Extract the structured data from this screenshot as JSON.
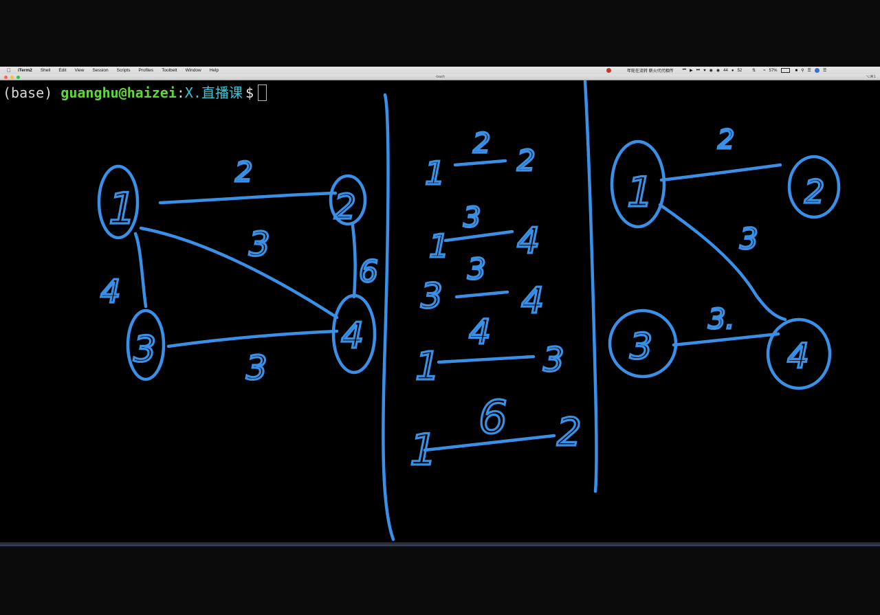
{
  "menubar": {
    "app_name": "iTerm2",
    "items": [
      "Shell",
      "Edit",
      "View",
      "Session",
      "Scripts",
      "Profiles",
      "Toolbelt",
      "Window",
      "Help"
    ],
    "now_playing": "年轮在流转 薪火代代相传",
    "badge_1": "44",
    "badge_2": "52",
    "battery": "57%"
  },
  "window": {
    "title": "-bash",
    "shortcut": "⌥⌘1"
  },
  "terminal": {
    "prompt_env": "(base)",
    "prompt_user": "guanghu@haizei",
    "prompt_sep": ":",
    "prompt_path": "X.直播课",
    "prompt_symbol": "$"
  },
  "annotation": {
    "color": "#3a8fe6",
    "left_graph": {
      "nodes": [
        "1",
        "2",
        "3",
        "4"
      ],
      "edges": [
        {
          "from": "1",
          "to": "2",
          "weight": "2"
        },
        {
          "from": "1",
          "to": "4",
          "weight": "3"
        },
        {
          "from": "1",
          "to": "3",
          "weight": "4"
        },
        {
          "from": "3",
          "to": "4",
          "weight": "3"
        },
        {
          "from": "2",
          "to": "4",
          "weight": "6"
        }
      ]
    },
    "sorted_edges": [
      {
        "u": "1",
        "w": "2",
        "v": "2"
      },
      {
        "u": "1",
        "w": "3",
        "v": "4"
      },
      {
        "u": "3",
        "w": "3",
        "v": "4"
      },
      {
        "u": "1",
        "w": "4",
        "v": "3"
      },
      {
        "u": "1",
        "w": "6",
        "v": "2"
      }
    ],
    "right_graph": {
      "nodes": [
        "1",
        "2",
        "3",
        "4"
      ],
      "edges": [
        {
          "from": "1",
          "to": "2",
          "weight": "2"
        },
        {
          "from": "1",
          "to": "4",
          "weight": "3"
        },
        {
          "from": "3",
          "to": "4",
          "weight": "3."
        }
      ]
    }
  }
}
